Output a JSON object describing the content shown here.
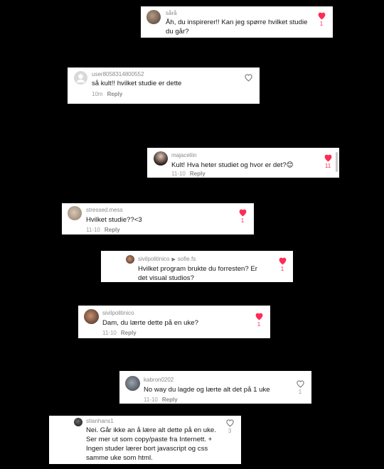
{
  "comments": [
    {
      "username": "sårå",
      "text": "Åh, du inspirerer!! Kan jeg spørre hvilket studie du går?",
      "liked": true,
      "likes": "1"
    },
    {
      "username": "user8058314800552",
      "text": "så kult!! hvilket studie er dette",
      "time": "10m",
      "reply": "Reply",
      "liked": false
    },
    {
      "username": "majaceliin",
      "text": "Kult! Hva heter studiet og hvor er det?😊",
      "time": "11-10",
      "reply": "Reply",
      "liked": true,
      "likes": "11"
    },
    {
      "username": "stressed.mess",
      "text": "Hvilket studie??<3",
      "time": "11-10",
      "reply": "Reply",
      "liked": true,
      "likes": "1"
    },
    {
      "username": "sivilpolitinico",
      "reply_to": "sofie.fs",
      "text": "Hvilket program brukte du forresten? Er det visual studios?",
      "liked": true,
      "likes": "1"
    },
    {
      "username": "sivilpolitinico",
      "text": "Dam, du lærte dette på en uke?",
      "time": "11-10",
      "reply": "Reply",
      "liked": true,
      "likes": "1"
    },
    {
      "username": "kabron0202",
      "text": "No way du lagde og lærte alt det på 1 uke",
      "time": "11-10",
      "reply": "Reply",
      "liked": false,
      "likes": "1"
    },
    {
      "username": "stianhans1",
      "text": "Nei. Går ikke an å lære alt dette på en uke. Ser mer ut som copy/paste fra Internett. + Ingen studer lærer bort javascript og css samme uke som html.",
      "liked": false,
      "likes": "3"
    }
  ],
  "colors": {
    "like_red": "#ff2b55",
    "username_grey": "#8a8a8a",
    "background": "#000000",
    "card": "#ffffff"
  },
  "icons": {
    "liked": "heart-filled-icon",
    "not_liked": "heart-outline-icon",
    "reply_arrow": "triangle-right-icon"
  }
}
